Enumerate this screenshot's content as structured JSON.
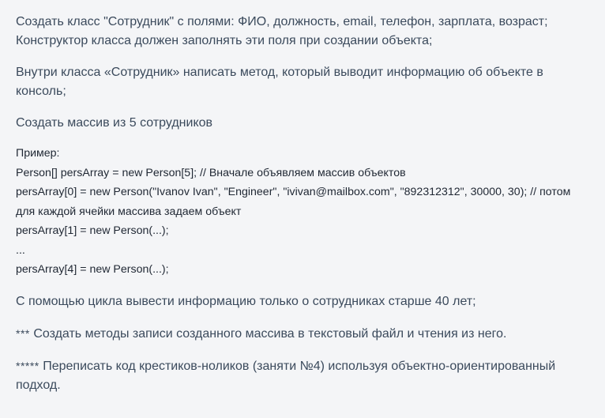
{
  "document": {
    "task1": "Создать класс \"Сотрудник\" с полями: ФИО, должность, email, телефон, зарплата, возраст; Конструктор класса должен заполнять эти поля при создании объекта;",
    "task2": "Внутри класса «Сотрудник» написать метод, который выводит информацию об объекте в консоль;",
    "task3": "Создать массив из 5 сотрудников",
    "example": {
      "heading": "Пример:",
      "line1": "Person[] persArray = new Person[5]; // Вначале объявляем массив объектов",
      "line2": "persArray[0] = new Person(\"Ivanov Ivan\", \"Engineer\", \"ivivan@mailbox.com\", \"892312312\", 30000, 30); // потом для каждой ячейки массива задаем объект",
      "line3": "persArray[1] = new Person(...);",
      "line4": "...",
      "line5": "persArray[4] = new Person(...);"
    },
    "task4": "С помощью цикла вывести информацию только о сотрудниках старше 40 лет;",
    "task5_stars": "***",
    "task5": "Создать методы записи созданного массива в текстовый файл и чтения из него.",
    "task6_stars": "*****",
    "task6": "Переписать код крестиков-ноликов (заняти №4) используя объектно-ориентированный подход."
  },
  "colors": {
    "background": "#f4f5f7",
    "heading_text": "#3b4a5c",
    "code_text": "#1f2733"
  }
}
